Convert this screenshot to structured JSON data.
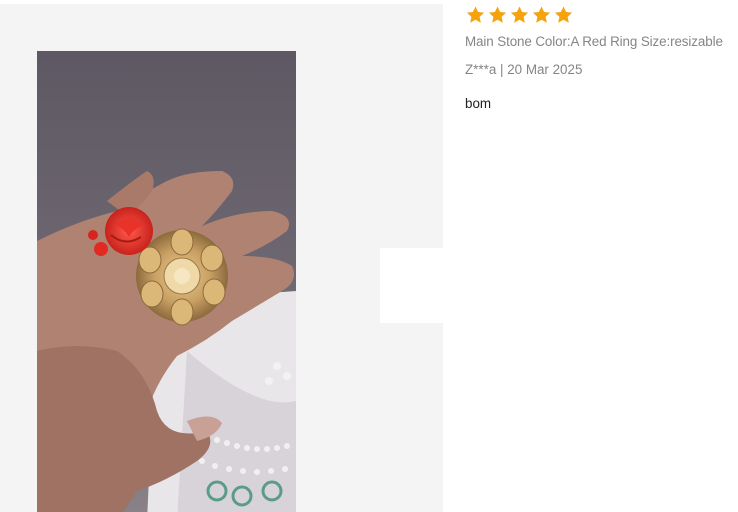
{
  "review": {
    "rating": 5,
    "rating_max": 5,
    "star_color": "#f5a20b",
    "sku_text": "Main Stone Color:A Red Ring Size:resizable",
    "author": "Z***a",
    "separator": "|",
    "date": "20 Mar 2025",
    "comment": "bom"
  },
  "gallery": {
    "photo_subject": "hand-wearing-red-rose-gold-flower-ring"
  }
}
